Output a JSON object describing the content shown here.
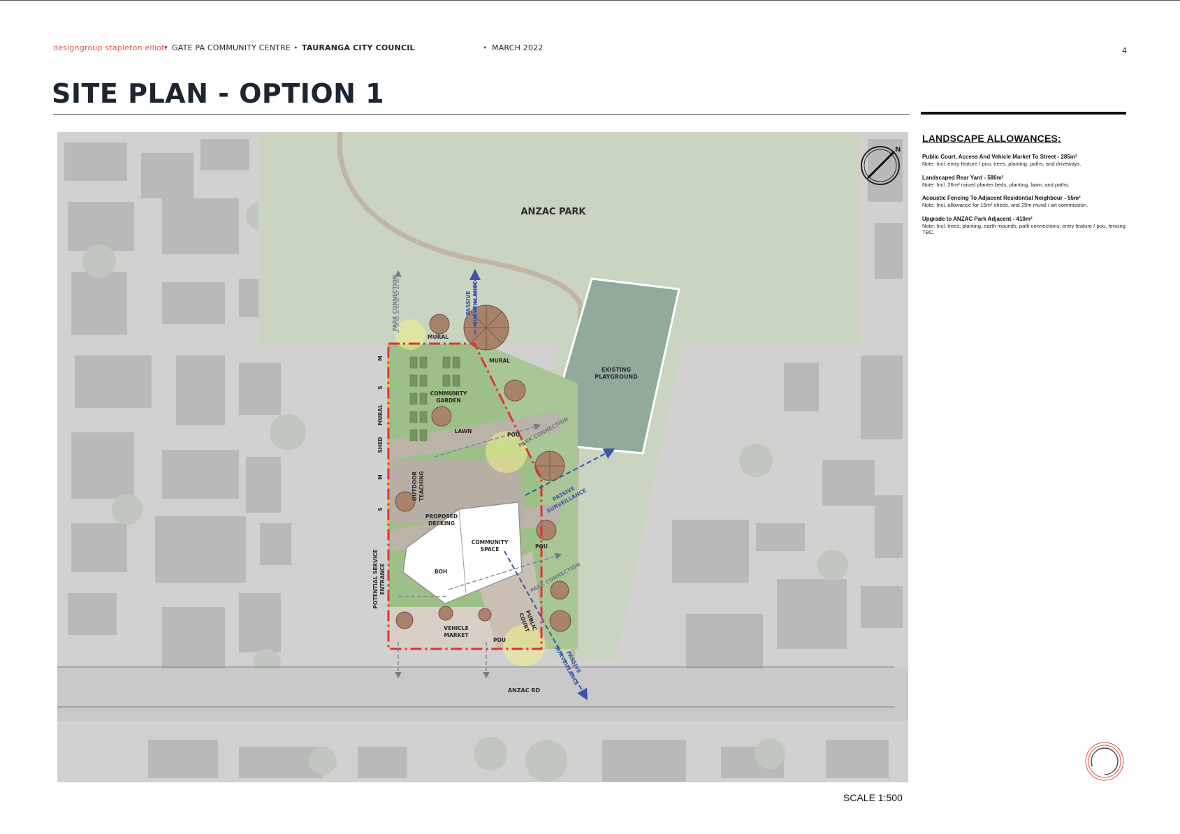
{
  "header": {
    "brand": "designgroup stapleton elliott",
    "project": "GATE PA COMMUNITY CENTRE",
    "client": "TAURANGA CITY COUNCIL",
    "date": "MARCH 2022",
    "bullet": "•"
  },
  "page_number": "4",
  "page_title": "SITE PLAN - OPTION 1",
  "landscape": {
    "heading": "LANDSCAPE ALLOWANCES:",
    "items": [
      {
        "title": "Public Court, Access And Vehicle Market To Street - 285m²",
        "note": "Note: Incl. entry feature / pou, trees, planting, paths, and driveways."
      },
      {
        "title": "Landscaped Rear Yard - 580m²",
        "note": "Note: Incl. 26m² raised planter beds, planting, lawn, and paths."
      },
      {
        "title": "Acoustic Fencing To Adjacent Residential Neighbour - 55m²",
        "note": "Note: Incl. allowance for 15m² sheds, and 25m mural / art commission."
      },
      {
        "title": "Upgrade to ANZAC Park Adjacent - 410m²",
        "note": "Note: Incl. trees, planting, earth mounds, path connections, entry feature / pou, fencing TBC."
      }
    ]
  },
  "plan": {
    "north": "N",
    "anzac_park": "ANZAC PARK",
    "playground_1": "EXISTING",
    "playground_2": "PLAYGROUND",
    "park_connection": "PARK CONNECTION",
    "passive_1": "PASSIVE",
    "passive_2": "SURVEILLANCE",
    "passive_slanted_1": "PASSIVE",
    "passive_slanted_2": "SURVEILLANCE",
    "mural": "MURAL",
    "community_garden_1": "COMMUNITY",
    "community_garden_2": "GARDEN",
    "lawn": "LAWN",
    "pou": "POU",
    "outdoor_teaching_1": "OUTDOOR",
    "outdoor_teaching_2": "TEACHING",
    "proposed_decking_1": "PROPOSED",
    "proposed_decking_2": "DECKING",
    "community_space_1": "COMMUNITY",
    "community_space_2": "SPACE",
    "boh": "BOH",
    "vehicle_market_1": "VEHICLE",
    "vehicle_market_2": "MARKET",
    "public_court_1": "PUBLIC",
    "public_court_2": "COURT",
    "potential_service_1": "POTENTIAL SERVICE",
    "potential_service_2": "ENTRANCE",
    "side_m": "M",
    "side_s": "S",
    "side_shed": "SHED",
    "anzac_rd": "ANZAC RD"
  },
  "scale": "SCALE 1:500",
  "colors": {
    "brand": "#e4514b",
    "boundary_red": "#e0332f",
    "passive_blue": "#3a55a8",
    "park_green": "#c7d2bf",
    "lawn_green": "#8fb57a"
  }
}
